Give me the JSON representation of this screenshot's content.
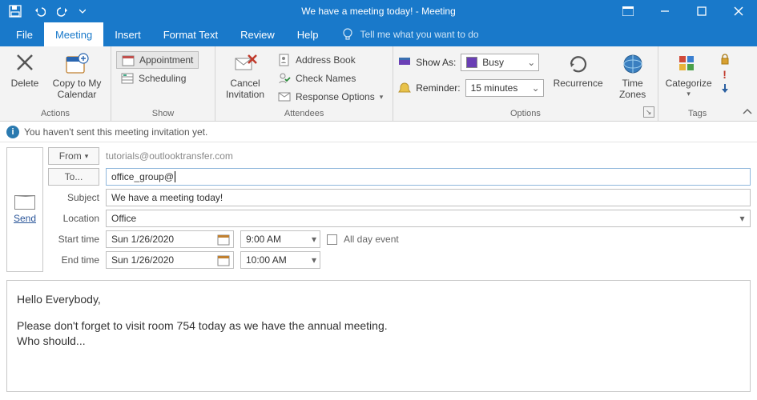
{
  "window": {
    "title": "We have a meeting today!  -  Meeting"
  },
  "tabs": {
    "file": "File",
    "meeting": "Meeting",
    "insert": "Insert",
    "format_text": "Format Text",
    "review": "Review",
    "help": "Help",
    "tellme": "Tell me what you want to do"
  },
  "ribbon": {
    "actions": {
      "label": "Actions",
      "delete": "Delete",
      "copy": "Copy to My Calendar"
    },
    "show": {
      "label": "Show",
      "appointment": "Appointment",
      "scheduling": "Scheduling"
    },
    "attendees": {
      "label": "Attendees",
      "cancel": "Cancel Invitation",
      "address_book": "Address Book",
      "check_names": "Check Names",
      "response_options": "Response Options"
    },
    "options": {
      "label": "Options",
      "show_as_label": "Show As:",
      "show_as_value": "Busy",
      "reminder_label": "Reminder:",
      "reminder_value": "15 minutes",
      "recurrence": "Recurrence",
      "time_zones": "Time Zones"
    },
    "tags": {
      "label": "Tags",
      "categorize": "Categorize"
    }
  },
  "infobar": {
    "text": "You haven't sent this meeting invitation yet."
  },
  "form": {
    "send": "Send",
    "from_label": "From",
    "from_value": "tutorials@outlooktransfer.com",
    "to_label": "To...",
    "to_value": "office_group@",
    "subject_label": "Subject",
    "subject_value": "We have a meeting today!",
    "location_label": "Location",
    "location_value": "Office",
    "start_label": "Start time",
    "start_date": "Sun 1/26/2020",
    "start_time": "9:00 AM",
    "end_label": "End time",
    "end_date": "Sun 1/26/2020",
    "end_time": "10:00 AM",
    "all_day": "All day event"
  },
  "body": {
    "line1": "Hello Everybody,",
    "line2": "Please don't forget to visit room 754 today as we have the annual meeting.",
    "line3": "Who should..."
  }
}
